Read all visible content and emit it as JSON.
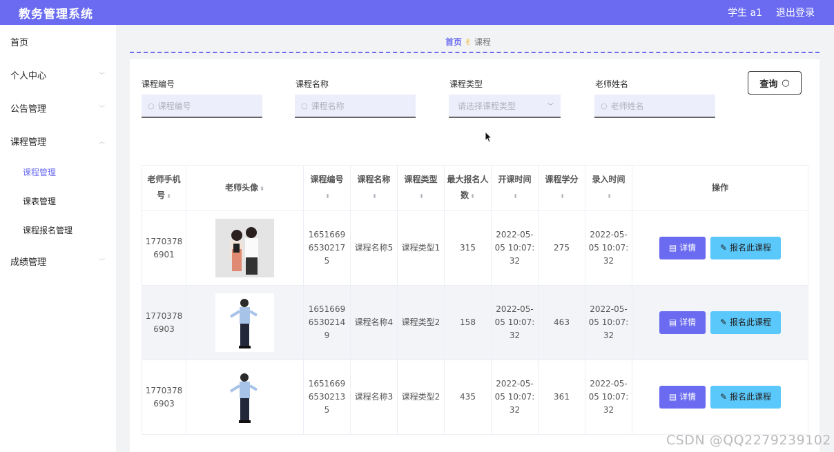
{
  "header": {
    "title": "教务管理系统",
    "user": "学生 a1",
    "logout": "退出登录",
    "color": "#6a6bf0"
  },
  "sidebar": {
    "items": [
      {
        "label": "首页"
      },
      {
        "label": "个人中心"
      },
      {
        "label": "公告管理"
      },
      {
        "label": "课程管理"
      },
      {
        "label": "课程管理"
      },
      {
        "label": "课表管理"
      },
      {
        "label": "课程报名管理"
      },
      {
        "label": "成绩管理"
      }
    ]
  },
  "breadcrumb": {
    "home": "首页",
    "separator_icon": "✌",
    "current": "课程"
  },
  "search": {
    "fields": [
      {
        "label": "课程编号",
        "placeholder": "课程编号"
      },
      {
        "label": "课程名称",
        "placeholder": "课程名称"
      },
      {
        "label": "课程类型",
        "placeholder": "请选择课程类型"
      },
      {
        "label": "老师姓名",
        "placeholder": "老师姓名"
      }
    ],
    "button": "查询"
  },
  "table": {
    "headers": [
      "老师手机号",
      "老师头像",
      "课程编号",
      "课程名称",
      "课程类型",
      "最大报名人数",
      "开课时间",
      "课程学分",
      "录入时间",
      "操作"
    ],
    "rows": [
      {
        "phone": "17703786901",
        "avatar": "teachers-with-tablet",
        "code": "16516696530217 5",
        "name": "课程名称5",
        "type": "课程类型1",
        "max": "315",
        "start": "2022-05-05 10:07:32",
        "credit": "275",
        "created": "2022-05-05 10:07:32"
      },
      {
        "phone": "17703786903",
        "avatar": "teacher-pointing",
        "code": "16516696530214 9",
        "name": "课程名称4",
        "type": "课程类型2",
        "max": "158",
        "start": "2022-05-05 10:07:32",
        "credit": "463",
        "created": "2022-05-05 10:07:32"
      },
      {
        "phone": "17703786903",
        "avatar": "teacher-pointing",
        "code": "16516696530213 5",
        "name": "课程名称3",
        "type": "课程类型2",
        "max": "435",
        "start": "2022-05-05 10:07:32",
        "credit": "361",
        "created": "2022-05-05 10:07:32"
      }
    ],
    "detail_label": "详情",
    "enroll_label": "报名此课程"
  },
  "watermark": "CSDN @QQ2279239102"
}
